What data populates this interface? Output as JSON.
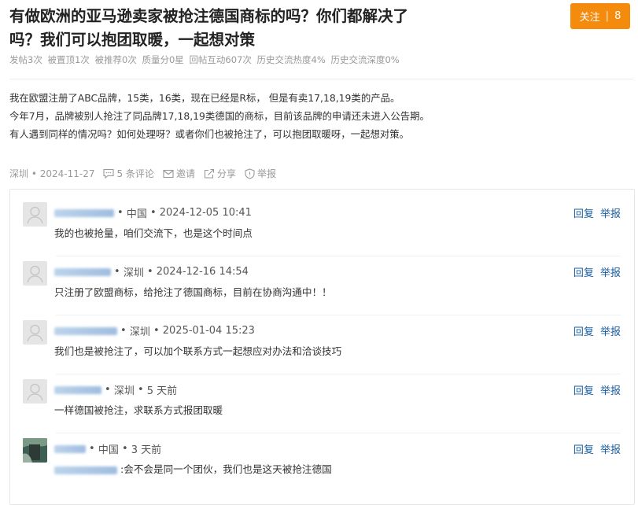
{
  "post": {
    "title": "有做欧洲的亚马逊卖家被抢注德国商标的吗？你们都解决了吗？我们可以抱团取暖，一起想对策",
    "follow_label": "关注",
    "follow_count": "8",
    "stats": [
      "发帖3次",
      "被置顶1次",
      "被推荐0次",
      "质量分0星",
      "回帖互动607次",
      "历史交流热度4%",
      "历史交流深度0%"
    ],
    "body": [
      " 我在欧盟注册了ABC品牌，15类，16类，现在已经是R标， 但是有卖17,18,19类的产品。",
      "今年7月，品牌被别人抢注了同品牌17,18,19类德国的商标，目前该品牌的申请还未进入公告期。",
      "有人遇到同样的情况吗？如何处理呀？或者你们也被抢注了，可以抱团取暖呀，一起想对策。"
    ],
    "meta": {
      "location": "深圳",
      "date": "2024-11-27",
      "comments_label": "5 条评论",
      "invite_label": "邀请",
      "share_label": "分享",
      "report_label": "举报"
    }
  },
  "comment_actions": {
    "reply": "回复",
    "report": "举报"
  },
  "comments": [
    {
      "location": "中国",
      "time": "2024-12-05 10:41",
      "text": "我的也被抢量，咱们交流下，也是这个时间点"
    },
    {
      "location": "深圳",
      "time": "2024-12-16 14:54",
      "text": "只注册了欧盟商标，给抢注了德国商标，目前在协商沟通中！！"
    },
    {
      "location": "深圳",
      "time": "2025-01-04 15:23",
      "text": "我们也是被抢注了，可以加个联系方式一起想应对办法和洽谈技巧"
    },
    {
      "location": "深圳",
      "time": "5 天前",
      "text": "一样德国被抢注，求联系方式报团取暖"
    },
    {
      "location": "中国",
      "time": "3 天前",
      "text": ":会不会是同一个团伙，我们也是这天被抢注德国"
    }
  ]
}
